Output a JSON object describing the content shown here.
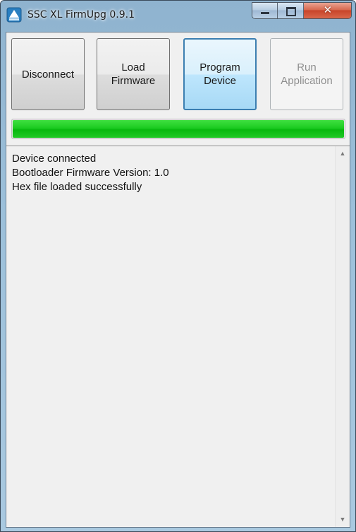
{
  "window": {
    "title": "SSC XL FirmUpg 0.9.1",
    "icon": "upload-triangle-icon",
    "caption": {
      "close_glyph": "✕"
    }
  },
  "toolbar": {
    "disconnect_label": "Disconnect",
    "load_label_line1": "Load",
    "load_label_line2": "Firmware",
    "program_label_line1": "Program",
    "program_label_line2": "Device",
    "run_label_line1": "Run",
    "run_label_line2": "Application"
  },
  "progress": {
    "fraction": 1.0,
    "color": "#1ccb21"
  },
  "log": {
    "lines": [
      "Device connected",
      "Bootloader Firmware Version: 1.0",
      "Hex file loaded successfully"
    ],
    "scroll_up_glyph": "▲",
    "scroll_down_glyph": "▼"
  }
}
